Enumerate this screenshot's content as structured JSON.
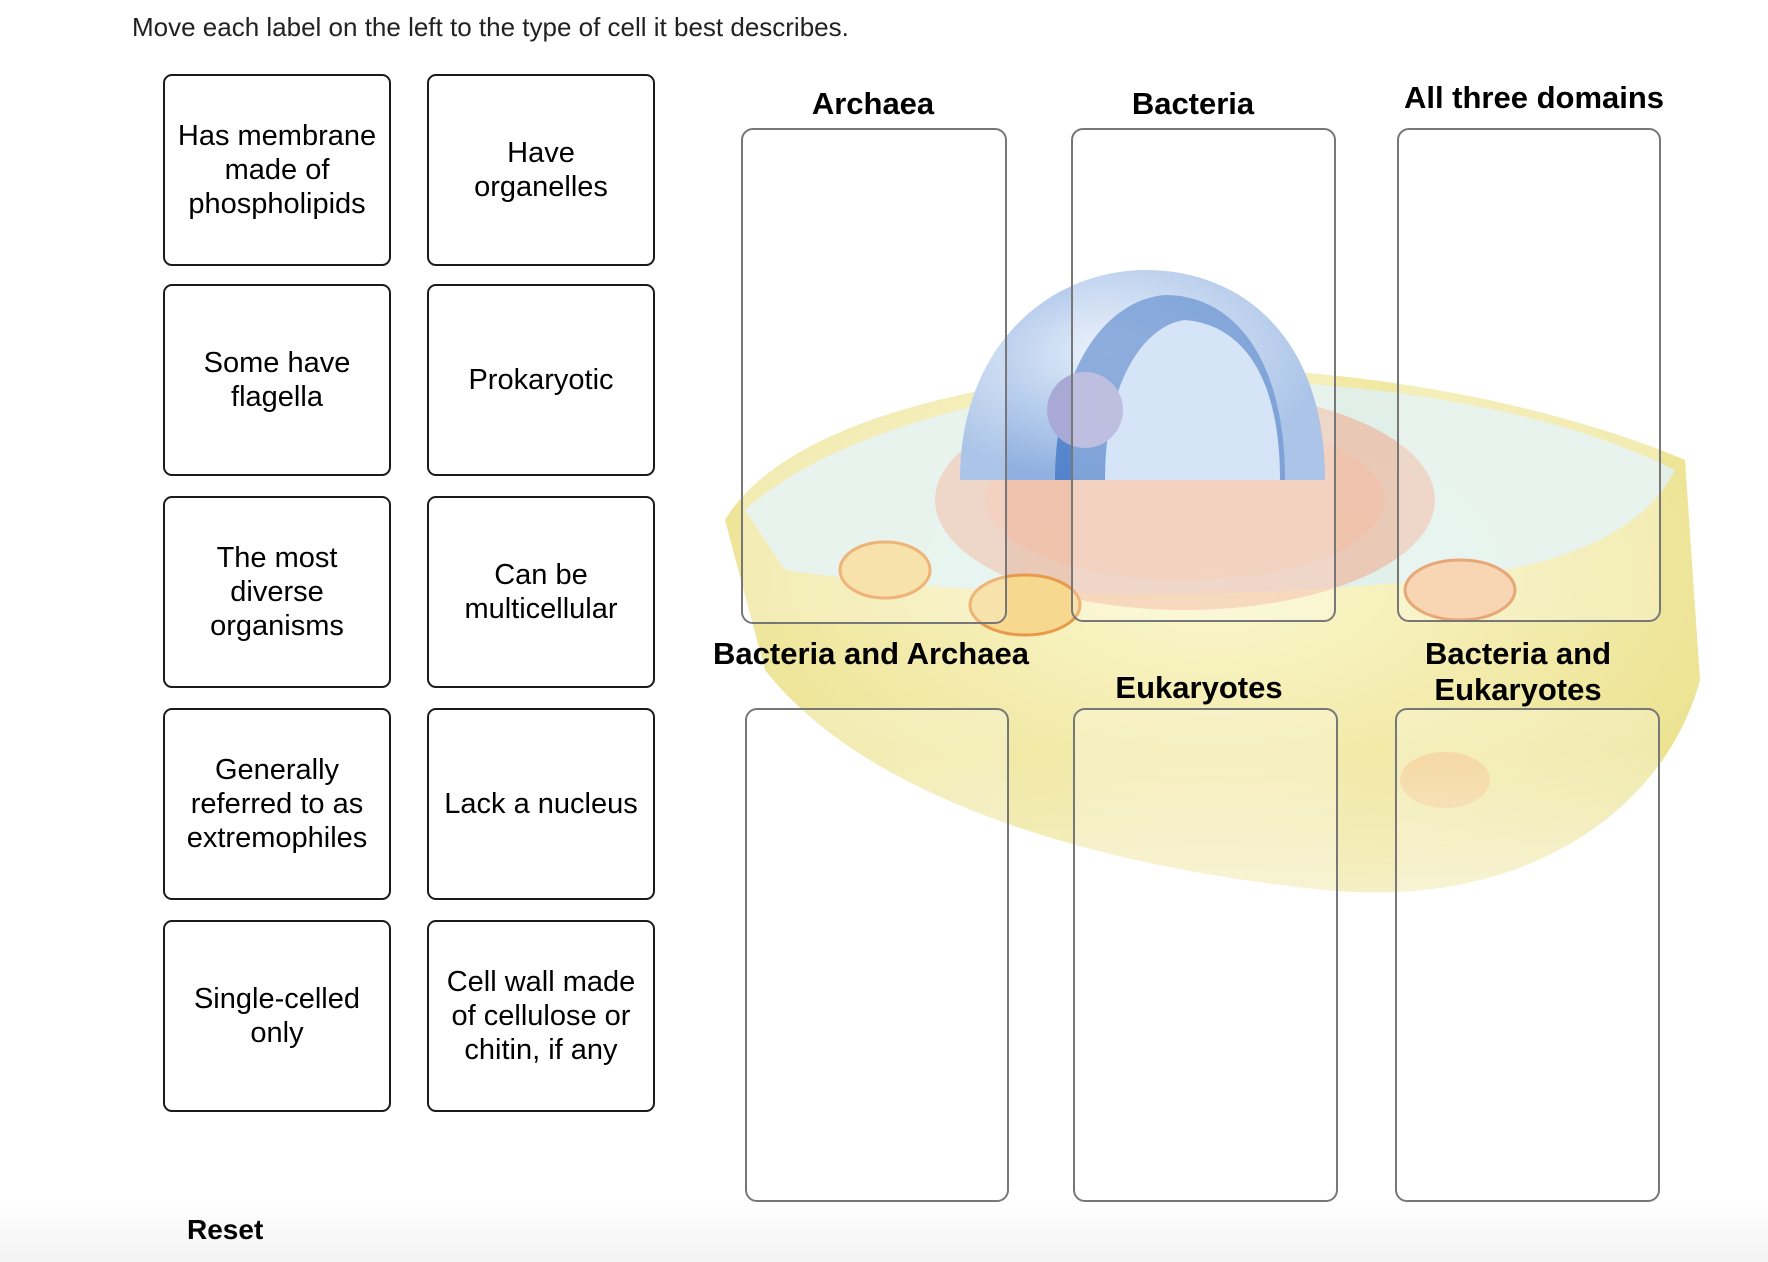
{
  "instructions": "Move each label on the left to the type of cell it best describes.",
  "labels": [
    {
      "text": "Has membrane made of phospholipids"
    },
    {
      "text": "Have organelles"
    },
    {
      "text": "Some have flagella"
    },
    {
      "text": "Prokaryotic"
    },
    {
      "text": "The most diverse organisms"
    },
    {
      "text": "Can be multicellular"
    },
    {
      "text": "Generally referred to as extremophiles"
    },
    {
      "text": "Lack a nucleus"
    },
    {
      "text": "Single-celled only"
    },
    {
      "text": "Cell wall made of cellulose or chitin, if any"
    }
  ],
  "targets": [
    {
      "heading": "Archaea"
    },
    {
      "heading": "Bacteria"
    },
    {
      "heading": "All three domains"
    },
    {
      "heading": "Bacteria and Archaea"
    },
    {
      "heading": "Eukaryotes"
    },
    {
      "heading": "Bacteria and Eukaryotes"
    }
  ],
  "background_image": {
    "icon": "eukaryotic-cell-illustration"
  },
  "reset_label": "Reset"
}
